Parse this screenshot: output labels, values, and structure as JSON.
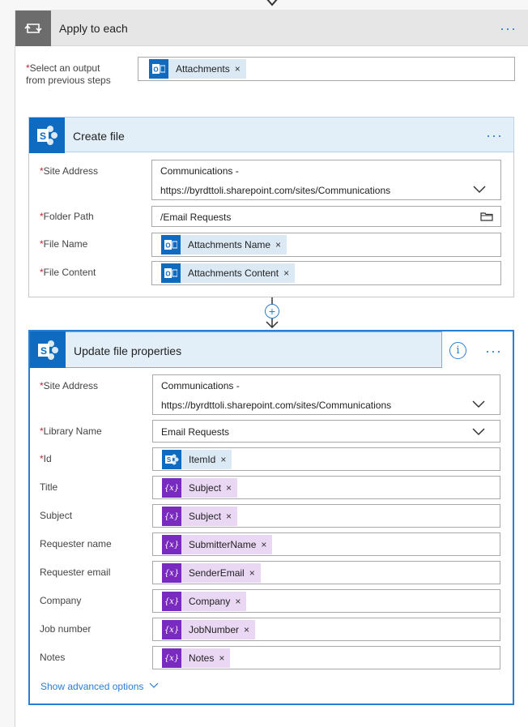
{
  "apply_to_each": {
    "title": "Apply to each",
    "more_label": "···",
    "select_output_label_line1": "Select an output",
    "select_output_label_line2": "from previous steps",
    "required_mark": "*",
    "token": {
      "icon": "outlook-icon",
      "text": "Attachments"
    }
  },
  "create_file": {
    "title": "Create file",
    "more_label": "···",
    "fields": {
      "site_address": {
        "label": "Site Address",
        "line1": "Communications -",
        "line2": "https://byrdttoli.sharepoint.com/sites/Communications"
      },
      "folder_path": {
        "label": "Folder Path",
        "value": "/Email Requests"
      },
      "file_name": {
        "label": "File Name",
        "token": "Attachments Name"
      },
      "file_content": {
        "label": "File Content",
        "token": "Attachments Content"
      }
    }
  },
  "update_file": {
    "title": "Update file properties",
    "more_label": "···",
    "info_label": "i",
    "fields": {
      "site_address": {
        "label": "Site Address",
        "line1": "Communications -",
        "line2": "https://byrdttoli.sharepoint.com/sites/Communications"
      },
      "library_name": {
        "label": "Library Name",
        "value": "Email Requests"
      },
      "id": {
        "label": "Id",
        "token": "ItemId"
      },
      "title": {
        "label": "Title",
        "token": "Subject"
      },
      "subject": {
        "label": "Subject",
        "token": "Subject"
      },
      "requester_name": {
        "label": "Requester name",
        "token": "SubmitterName"
      },
      "requester_email": {
        "label": "Requester email",
        "token": "SenderEmail"
      },
      "company": {
        "label": "Company",
        "token": "Company"
      },
      "job_number": {
        "label": "Job number",
        "token": "JobNumber"
      },
      "notes": {
        "label": "Notes",
        "token": "Notes"
      }
    },
    "show_advanced": "Show advanced options"
  },
  "token_remove_glyph": "×",
  "expression_glyph": "{x}",
  "add_step_glyph": "+",
  "colors": {
    "accent": "#2b7cd3",
    "sharepoint": "#0f6bbf",
    "expression": "#7a2bbf",
    "required": "#c4262e"
  }
}
